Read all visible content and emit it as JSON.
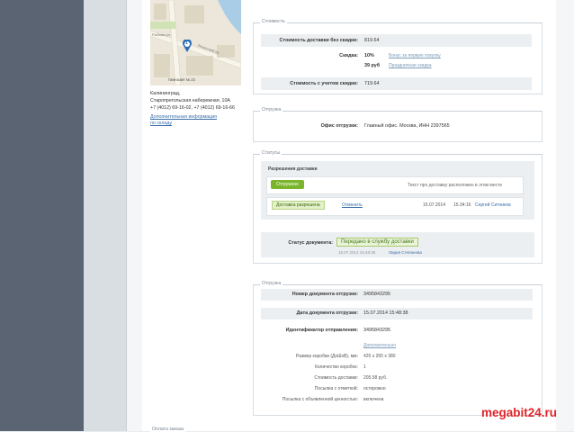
{
  "map": {
    "street_1": "Рыбная ул.",
    "street_2": "Ленинский пр.",
    "marker": "1",
    "caption": "Гимназия № 23"
  },
  "address": {
    "city": "Калининград,",
    "street": "Старопрегольская набережная, 10А",
    "phones": "+7 (4012) 69-16-02, +7 (4012) 69-16-66",
    "info_link_1": "Дополнительная информация",
    "info_link_2": "по складу"
  },
  "cost": {
    "legend": "Стоимость",
    "delivery_label": "Стоимость доставки без скидки:",
    "delivery_value": "819.64",
    "discount_label": "Скидка:",
    "discount_pct": "10%",
    "discount_link": "Бонус за первую покупку",
    "discount_rub": "39 руб",
    "discount_link2": "Праздничная скидка",
    "total_label": "Стоимость с учетом скидки:",
    "total_value": "719.64"
  },
  "shipment1": {
    "legend": "Отгрузка",
    "office_label": "Офис отгрузки:",
    "office_value": "Главный офис. Москва, ИНН 2397565"
  },
  "statuses": {
    "legend": "Статусы",
    "box_title": "Разрешения доставки",
    "shipped_btn": "Отгружено",
    "note": "Текст про доставку расположен в этом месте",
    "allowed_tag": "Доставка разрешена",
    "cancel_link": "Отменить",
    "date": "15.07.2014",
    "time": "15:34:16",
    "user": "Сергей Ситников",
    "doc_status_label": "Статус документа:",
    "doc_status_value": "Передано в службу доставки",
    "doc_status_meta": "15.07.2014 15:48:38",
    "doc_status_user": "Лидия Степанова"
  },
  "shipment2": {
    "legend": "Отгрузка",
    "doc_num_label": "Номер документа отгрузки:",
    "doc_num_value": "3495843295",
    "doc_date_label": "Дата документа отгрузки:",
    "doc_date_value": "15.07.2014 15:48:38",
    "sender_id_label": "Идентификатор отправления:",
    "sender_id_value": "3495843295",
    "extra_link": "Дополнительно",
    "box_size_label": "Размер коробки (ДхШхВ), мм:",
    "box_size_value": "425 x 265 x 380",
    "box_count_label": "Количество коробок:",
    "box_count_value": "1",
    "delivery_cost_label": "Стоимость доставки:",
    "delivery_cost_value": "205.58 руб.",
    "marked_label": "Посылка с отметкой:",
    "marked_value": "осторожно",
    "declared_label": "Посылка с объявленной ценностью:",
    "declared_value": "включена"
  },
  "footer": {
    "legend": "Оплата заказа"
  },
  "watermark": "megabit24.ru"
}
